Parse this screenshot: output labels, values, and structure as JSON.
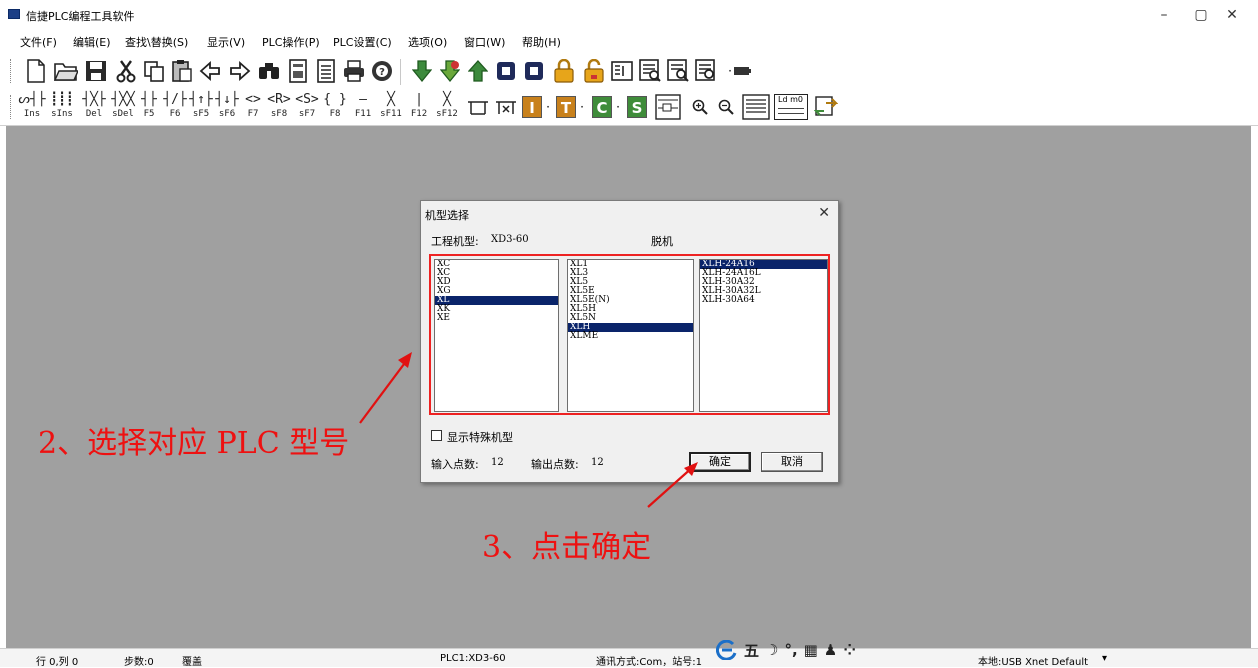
{
  "window": {
    "title": "信捷PLC编程工具软件",
    "minimize_glyph": "–",
    "restore_glyph": "▢",
    "close_glyph": "✕"
  },
  "menu": [
    {
      "label": "文件(F)"
    },
    {
      "label": "编辑(E)"
    },
    {
      "label": "查找\\替换(S)"
    },
    {
      "label": "显示(V)"
    },
    {
      "label": "PLC操作(P)"
    },
    {
      "label": "PLC设置(C)"
    },
    {
      "label": "选项(O)"
    },
    {
      "label": "窗口(W)"
    },
    {
      "label": "帮助(H)"
    }
  ],
  "toolbar1": {
    "icons": [
      "new-file-icon",
      "open-folder-icon",
      "save-icon",
      "cut-icon",
      "copy-icon",
      "paste-icon",
      "back-arrow-icon",
      "forward-arrow-icon",
      "find-binoculars-icon",
      "monitor-icon",
      "list-icon",
      "print-icon",
      "help-icon",
      "download-icon",
      "upload-icon",
      "up-arrow-icon",
      "stop-icon",
      "run-icon",
      "lock-icon",
      "unlock-icon",
      "image-icon",
      "ladder-view-icon",
      "instruction-view-icon",
      "data-view-icon",
      "more-icon"
    ]
  },
  "toolbar2": {
    "ladder_keys": [
      {
        "sym": "ᔕ┤├",
        "key": "Ins"
      },
      {
        "sym": "┋┋┋",
        "key": "sIns"
      },
      {
        "sym": "┤╳├",
        "key": "Del"
      },
      {
        "sym": "┤╳╳",
        "key": "sDel"
      },
      {
        "sym": "┤├",
        "key": "F5"
      },
      {
        "sym": "┤/├",
        "key": "F6"
      },
      {
        "sym": "┤↑├",
        "key": "sF5"
      },
      {
        "sym": "┤↓├",
        "key": "sF6"
      },
      {
        "sym": "<>",
        "key": "F7"
      },
      {
        "sym": "<R>",
        "key": "sF8"
      },
      {
        "sym": "<S>",
        "key": "sF7"
      },
      {
        "sym": "{ }",
        "key": "F8"
      },
      {
        "sym": "—",
        "key": "F11"
      },
      {
        "sym": "╳",
        "key": "sF11"
      },
      {
        "sym": "|",
        "key": "F12"
      },
      {
        "sym": "╳",
        "key": "sF12"
      }
    ],
    "color_buttons": [
      {
        "letter": "I",
        "color": "#c8811c"
      },
      {
        "letter": "T",
        "color": "#c8811c"
      },
      {
        "letter": "C",
        "color": "#3f8c3a"
      },
      {
        "letter": "S",
        "color": "#3f8c3a"
      }
    ],
    "ld_label": "Ld m0"
  },
  "dialog": {
    "title": "机型选择",
    "close_glyph": "✕",
    "project_model_label": "工程机型:",
    "project_model_value": "XD3-60",
    "offline_label": "脱机",
    "series_list": [
      "XC",
      "XC",
      "XD",
      "XG",
      "XL",
      "XK",
      "XE"
    ],
    "series_selected_index": 4,
    "model_list": [
      "XL1",
      "XL3",
      "XL5",
      "XL5E",
      "XL5E(N)",
      "XL5H",
      "XL5N",
      "XLH",
      "XLME"
    ],
    "model_selected_index": 7,
    "variant_list": [
      "XLH-24A16",
      "XLH-24A16L",
      "XLH-30A32",
      "XLH-30A32L",
      "XLH-30A64"
    ],
    "variant_selected_index": 0,
    "special_checkbox_label": "显示特殊机型",
    "input_points_label": "输入点数:",
    "input_points_value": "12",
    "output_points_label": "输出点数:",
    "output_points_value": "12",
    "ok_button": "确定",
    "cancel_button": "取消"
  },
  "annotations": {
    "step2": "2、选择对应 PLC 型号",
    "step3": "3、点击确定",
    "color": "#e11111"
  },
  "statusbar": {
    "rowcol": "行 0,列 0",
    "steps": "步数:0",
    "mode": "覆盖",
    "plc": "PLC1:XD3-60",
    "comm": "通讯方式:Com，站号:1",
    "connection": "本地:USB Xnet Default",
    "connection_arrow": "▾",
    "ime_label": "五"
  }
}
